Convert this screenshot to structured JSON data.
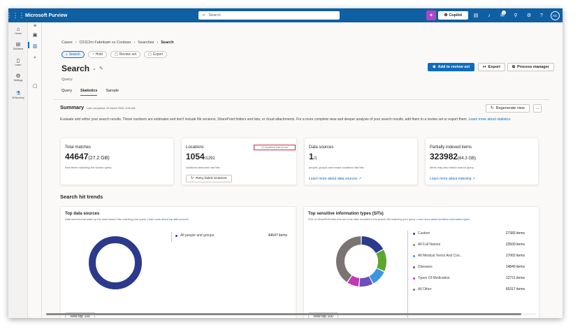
{
  "app": {
    "name": "Microsoft Purview",
    "search_placeholder": "Search",
    "copilot_label": "Copilot",
    "notification_count": "1",
    "avatar_initials": "NC"
  },
  "nav": {
    "rail": [
      {
        "label": "Home",
        "icon": "home-icon"
      },
      {
        "label": "Solutions",
        "icon": "solutions-icon"
      },
      {
        "label": "Learn",
        "icon": "learn-icon"
      },
      {
        "label": "Settings",
        "icon": "settings-icon"
      },
      {
        "label": "eDiscovery",
        "icon": "ediscovery-icon"
      }
    ]
  },
  "breadcrumb": [
    "Cases",
    "C0112m Fabrikam vs Contoso",
    "Searches",
    "Search"
  ],
  "pills": [
    "Search",
    "Hold",
    "Review set",
    "Export"
  ],
  "page": {
    "title": "Search",
    "query_label": "Query:"
  },
  "tabs": [
    "Query",
    "Statistics",
    "Sample"
  ],
  "actions": {
    "add_to_review": "Add to review set",
    "export": "Export",
    "process_manager": "Process manager"
  },
  "summary": {
    "title": "Summary",
    "timestamp": "Last completed: 20 March 2025, 8:59 AM",
    "regenerate": "Regenerate view",
    "description": "Evaluate and refine your search results. These numbers are estimates and don't include file versions, SharePoint folders and lists, or cloud attachments. For a more complete view and deeper analysis of your search results, add them to a review set or export them.",
    "learn_more": "Learn more about statistics"
  },
  "stats": {
    "total": {
      "label": "Total matches",
      "value": "44647",
      "size": "(27.2 GB)",
      "sub": "total items matching the search query"
    },
    "locations": {
      "label": "Locations",
      "value": "1054",
      "of": "/1291",
      "sub": "locations searched had hits",
      "error": "11 locations had errors",
      "retry": "Retry failed locations"
    },
    "sources": {
      "label": "Data sources",
      "value": "1",
      "of": "/1",
      "sub": "people, groups and tenant locations had hits",
      "link": "Learn more about data sources"
    },
    "partial": {
      "label": "Partially indexed items",
      "value": "323982",
      "size": "(64.3 GB)",
      "sub": "items may also match search query",
      "link": "Learn more about indexing"
    }
  },
  "trends": {
    "title": "Search hit trends",
    "top_sources": {
      "title": "Top data sources",
      "desc": "Data sources that make up the most search hits matching your query.",
      "link": "Learn more about top data sources",
      "items": [
        {
          "name": "All people and groups",
          "value": "44647 items",
          "color": "#2b3a8c"
        }
      ],
      "view_top": "View top 100"
    },
    "top_sits": {
      "title": "Top sensitive information types (SITs)",
      "desc": "SITs on SharePoint files that are most often included in the search hits matching your query.",
      "link": "Learn more about sensitive information types",
      "items": [
        {
          "name": "Custom",
          "value": "27383 items",
          "color": "#2b3a8c"
        },
        {
          "name": "All Full Names",
          "value": "23500 items",
          "color": "#5ea52f"
        },
        {
          "name": "All Medical Terms And Con...",
          "value": "17062 items",
          "color": "#3a96dd"
        },
        {
          "name": "Diseases",
          "value": "14849 items",
          "color": "#6b4fbb"
        },
        {
          "name": "Types Of Medication",
          "value": "12711 items",
          "color": "#c239b3"
        },
        {
          "name": "All Other",
          "value": "65317 items",
          "color": "#7a7574"
        }
      ],
      "view_top": "View top 100"
    }
  }
}
